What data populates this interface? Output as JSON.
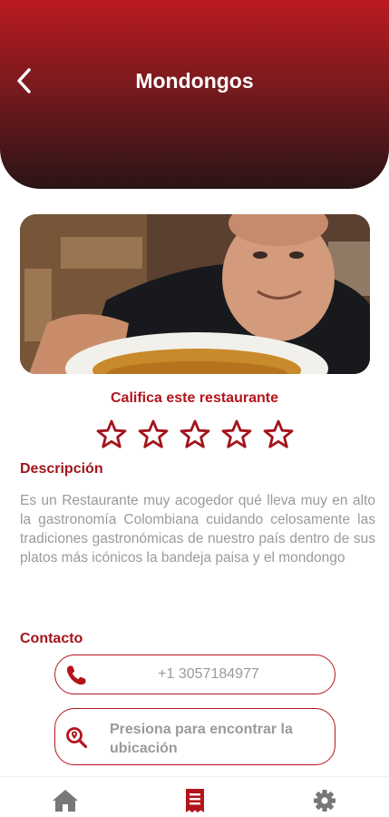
{
  "header": {
    "title": "Mondongos",
    "back_icon": "chevron-left-icon"
  },
  "photo": {
    "alt": "Chef holding bowl of mondongo"
  },
  "rating": {
    "label": "Califica este restaurante",
    "max_stars": 5,
    "current": 0
  },
  "description": {
    "title": "Descripción",
    "text": "Es un Restaurante muy acogedor qué lleva muy en alto la gastronomía Colombiana cuidando celosamente las tradiciones gastronómicas de nuestro país dentro de sus platos más icónicos la bandeja paisa y el mondongo"
  },
  "contact": {
    "title": "Contacto",
    "phone": "+1 3057184977",
    "location_label": "Presiona para encontrar la ubicación"
  },
  "nav": {
    "items": [
      {
        "name": "home",
        "icon": "home-icon"
      },
      {
        "name": "menu",
        "icon": "receipt-icon",
        "active": true
      },
      {
        "name": "settings",
        "icon": "gear-icon"
      }
    ]
  },
  "colors": {
    "accent": "#b3141b",
    "header_top": "#bb1b21",
    "header_bottom": "#2a1416",
    "text_muted": "#9a9a9a",
    "nav_inactive": "#777777"
  }
}
